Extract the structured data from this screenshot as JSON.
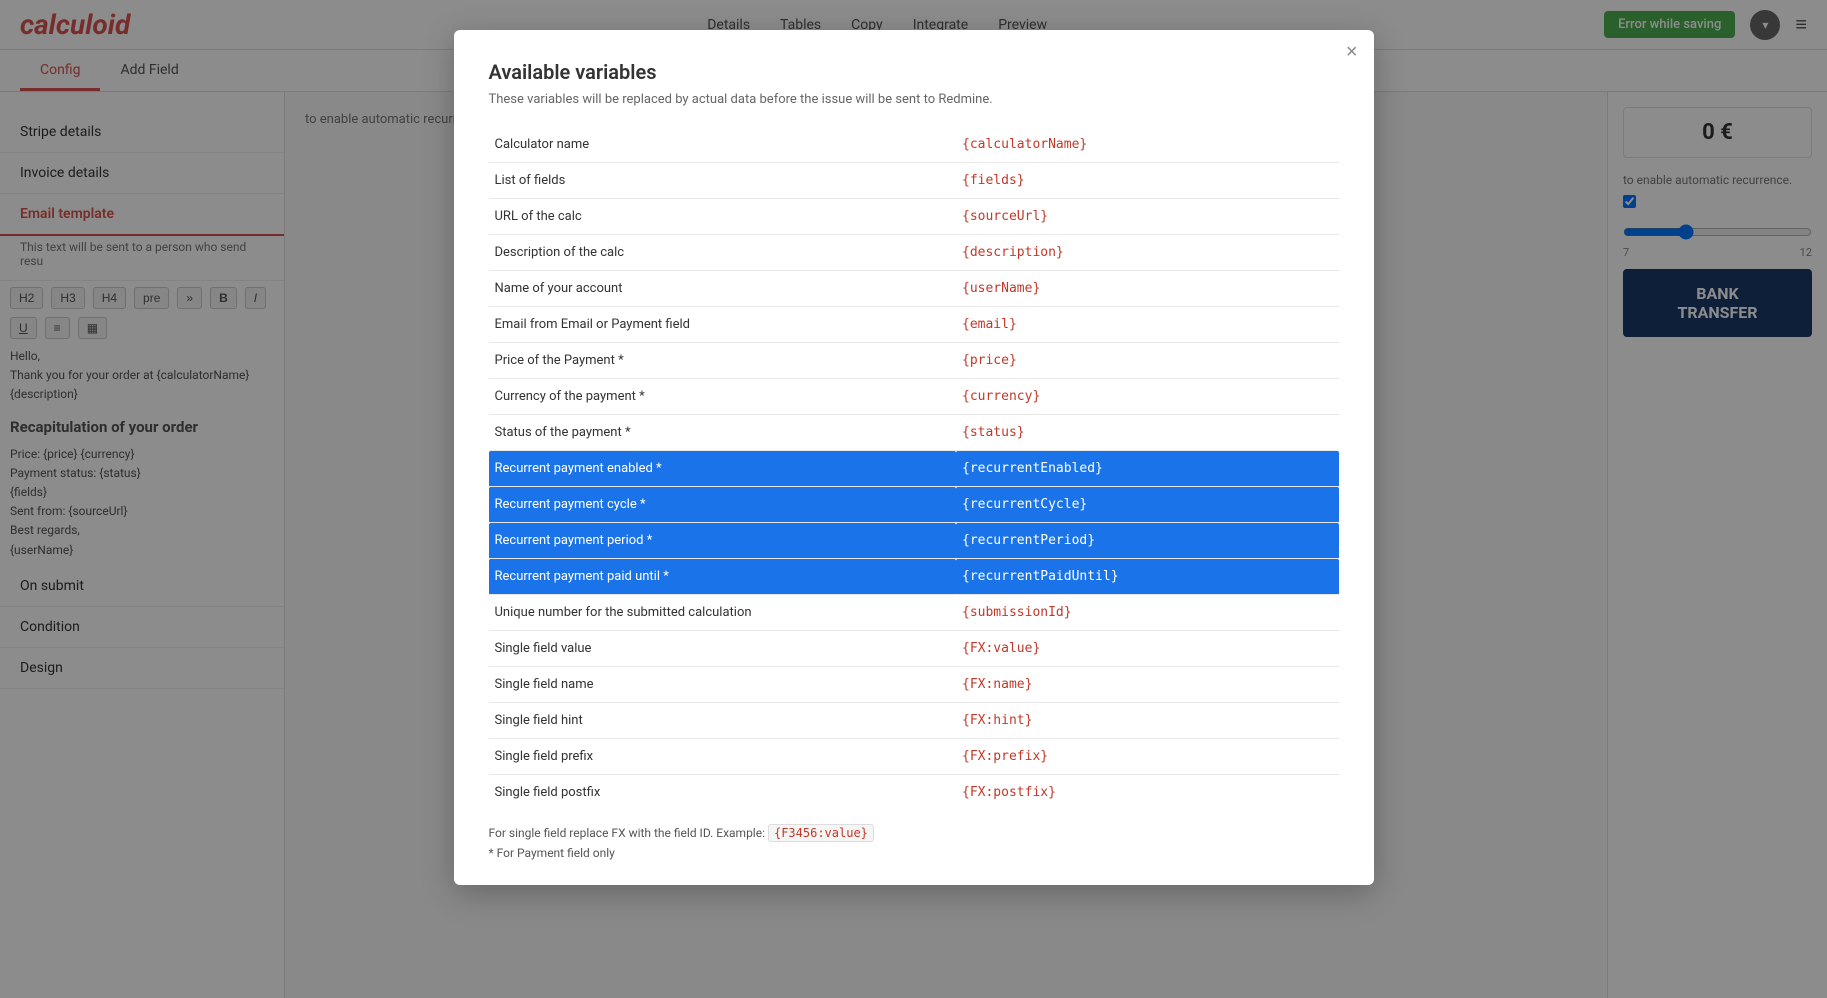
{
  "app": {
    "logo": "calculoid",
    "error_badge": "Error while saving",
    "nav": {
      "links": [
        "Details",
        "Tables",
        "Copy",
        "Integrate",
        "Preview"
      ],
      "user_icon": "▾",
      "hamburger": "≡"
    },
    "sub_tabs": [
      "Config",
      "Add Field"
    ],
    "active_sub_tab": "Config"
  },
  "sidebar": {
    "items": [
      {
        "label": "Stripe details",
        "id": "stripe-details"
      },
      {
        "label": "Invoice details",
        "id": "invoice-details"
      },
      {
        "label": "Email template",
        "id": "email-template",
        "active": true
      },
      {
        "label": "On submit",
        "id": "on-submit"
      },
      {
        "label": "Condition",
        "id": "condition"
      },
      {
        "label": "Design",
        "id": "design"
      }
    ],
    "email_template_note": "This text will be sent to a person who send resu"
  },
  "editor": {
    "toolbar": [
      "H2",
      "H3",
      "H4",
      "pre",
      "»",
      "B",
      "I",
      "U",
      "≡",
      "▦"
    ],
    "content_lines": [
      "Hello,",
      "",
      "Thank you for your order at {calculatorName}",
      "",
      "{description}",
      "",
      "Recapitulation of your order:",
      "",
      "Price: {price} {currency}",
      "Payment status: {status}",
      "{fields}",
      "Sent from: {sourceUrl}",
      "",
      "Best regards,",
      "{userName}"
    ]
  },
  "right_panel": {
    "amount": "0 €",
    "recurrence_label": "to enable automatic recurrence.",
    "slider_values": {
      "min": "7",
      "max": "12"
    }
  },
  "modal": {
    "title": "Available variables",
    "subtitle": "These variables will be replaced by actual data before the issue will be sent to Redmine.",
    "close_label": "×",
    "variables": [
      {
        "label": "Calculator name",
        "variable": "{calculatorName}",
        "highlighted": false
      },
      {
        "label": "List of fields",
        "variable": "{fields}",
        "highlighted": false
      },
      {
        "label": "URL of the calc",
        "variable": "{sourceUrl}",
        "highlighted": false
      },
      {
        "label": "Description of the calc",
        "variable": "{description}",
        "highlighted": false
      },
      {
        "label": "Name of your account",
        "variable": "{userName}",
        "highlighted": false
      },
      {
        "label": "Email from Email or Payment field",
        "variable": "{email}",
        "highlighted": false
      },
      {
        "label": "Price of the Payment *",
        "variable": "{price}",
        "highlighted": false
      },
      {
        "label": "Currency of the payment *",
        "variable": "{currency}",
        "highlighted": false
      },
      {
        "label": "Status of the payment *",
        "variable": "{status}",
        "highlighted": false
      },
      {
        "label": "Recurrent payment enabled *",
        "variable": "{recurrentEnabled}",
        "highlighted": true
      },
      {
        "label": "Recurrent payment cycle *",
        "variable": "{recurrentCycle}",
        "highlighted": true
      },
      {
        "label": "Recurrent payment period *",
        "variable": "{recurrentPeriod}",
        "highlighted": true
      },
      {
        "label": "Recurrent payment paid until *",
        "variable": "{recurrentPaidUntil}",
        "highlighted": true
      },
      {
        "label": "Unique number for the submitted calculation",
        "variable": "{submissionId}",
        "highlighted": false
      },
      {
        "label": "Single field value",
        "variable": "{FX:value}",
        "highlighted": false
      },
      {
        "label": "Single field name",
        "variable": "{FX:name}",
        "highlighted": false
      },
      {
        "label": "Single field hint",
        "variable": "{FX:hint}",
        "highlighted": false
      },
      {
        "label": "Single field prefix",
        "variable": "{FX:prefix}",
        "highlighted": false
      },
      {
        "label": "Single field postfix",
        "variable": "{FX:postfix}",
        "highlighted": false
      }
    ],
    "footer_note": "For single field replace FX with the field ID. Example:",
    "footer_code": "{F3456:value}",
    "footer_asterisk": "* For Payment field only"
  },
  "colors": {
    "logo_red": "#d9534f",
    "error_green": "#4CAF50",
    "highlight_blue": "#1a73e8",
    "var_red": "#c0392b",
    "nav_active_red": "#d9534f"
  }
}
